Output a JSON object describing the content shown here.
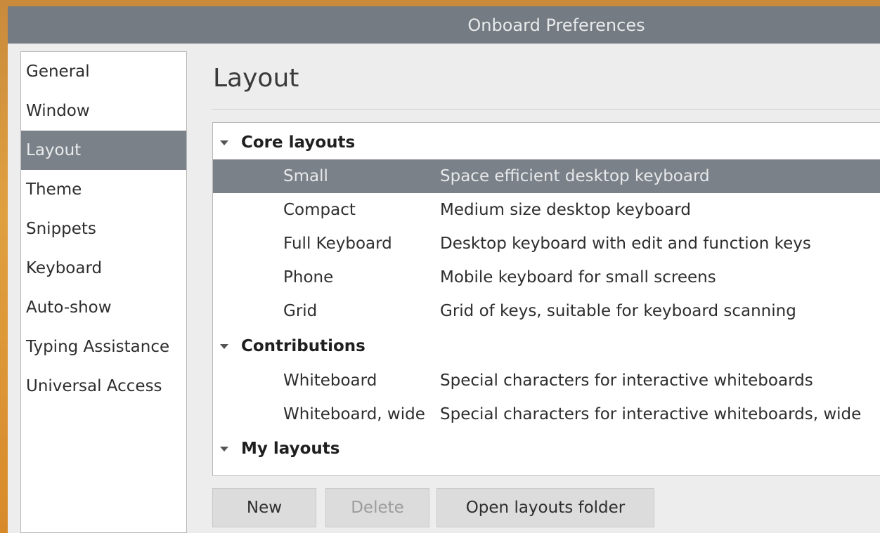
{
  "window": {
    "title": "Onboard Preferences"
  },
  "sidebar": {
    "items": [
      {
        "label": "General"
      },
      {
        "label": "Window"
      },
      {
        "label": "Layout",
        "selected": true
      },
      {
        "label": "Theme"
      },
      {
        "label": "Snippets"
      },
      {
        "label": "Keyboard"
      },
      {
        "label": "Auto-show"
      },
      {
        "label": "Typing Assistance"
      },
      {
        "label": "Universal Access"
      }
    ]
  },
  "main": {
    "title": "Layout",
    "groups": {
      "core": {
        "label": "Core layouts",
        "items": [
          {
            "name": "Small",
            "description": "Space efficient desktop keyboard",
            "selected": true
          },
          {
            "name": "Compact",
            "description": "Medium size desktop keyboard"
          },
          {
            "name": "Full Keyboard",
            "description": "Desktop keyboard with edit and function keys"
          },
          {
            "name": "Phone",
            "description": "Mobile keyboard for small screens"
          },
          {
            "name": "Grid",
            "description": "Grid of keys, suitable for keyboard scanning"
          }
        ]
      },
      "contributions": {
        "label": "Contributions",
        "items": [
          {
            "name": "Whiteboard",
            "description": "Special characters for interactive whiteboards"
          },
          {
            "name": "Whiteboard, wide",
            "description": "Special characters for interactive whiteboards, wide"
          }
        ]
      },
      "mine": {
        "label": "My layouts",
        "items": []
      }
    },
    "buttons": {
      "new": "New",
      "delete": "Delete",
      "open_folder": "Open layouts folder"
    }
  },
  "colors": {
    "titlebar": "#747b82",
    "selection": "#7b8188",
    "background": "#ededed"
  }
}
